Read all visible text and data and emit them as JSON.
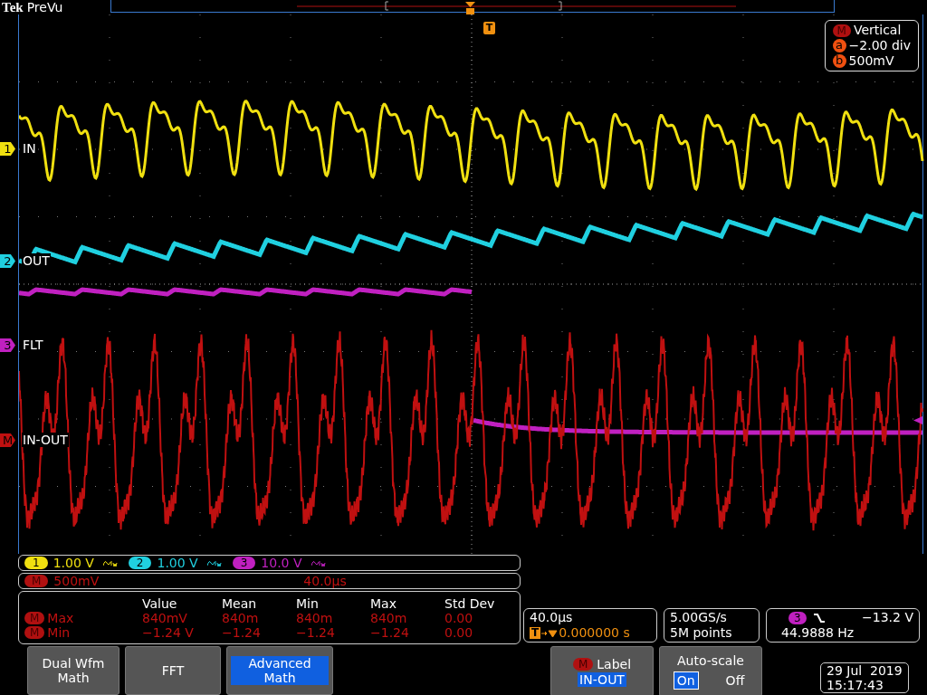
{
  "header": {
    "brand": "Tek",
    "mode": "PreVu",
    "trigger_marker": "T"
  },
  "channels": [
    {
      "number": "1",
      "label": "IN",
      "color": "#f0e010"
    },
    {
      "number": "2",
      "label": "OUT",
      "color": "#20d0e0"
    },
    {
      "number": "3",
      "label": "FLT",
      "color": "#c020c0"
    },
    {
      "number": "M",
      "label": "IN-OUT",
      "color": "#c01010"
    }
  ],
  "vertical_box": {
    "badge": "M",
    "title": "Vertical",
    "rows": [
      {
        "key": "a",
        "value": "−2.00 div"
      },
      {
        "key": "b",
        "value": "500mV"
      }
    ]
  },
  "channel_bar": [
    {
      "badge": "1",
      "scale": "1.00 V",
      "color": "#f0e010"
    },
    {
      "badge": "2",
      "scale": "1.00 V",
      "color": "#20d0e0"
    },
    {
      "badge": "3",
      "scale": "10.0 V",
      "color": "#c020c0"
    }
  ],
  "math_bar": {
    "badge": "M",
    "scale": "500mV",
    "time": "40.0µs"
  },
  "measurements": {
    "columns": [
      "Value",
      "Mean",
      "Min",
      "Max",
      "Std Dev"
    ],
    "rows": [
      {
        "badge": "M",
        "name": "Max",
        "values": [
          "840mV",
          "840m",
          "840m",
          "840m",
          "0.00"
        ]
      },
      {
        "badge": "M",
        "name": "Min",
        "values": [
          "−1.24 V",
          "−1.24",
          "−1.24",
          "−1.24",
          "0.00"
        ]
      }
    ]
  },
  "horizontal": {
    "scale": "40.0µs",
    "badge": "T",
    "position": "0.000000 s"
  },
  "acquisition": {
    "rate": "5.00GS/s",
    "length": "5M points"
  },
  "trigger": {
    "source": "3",
    "level": "−13.2 V",
    "frequency": "44.9888 Hz"
  },
  "menu": [
    {
      "label": "Dual Wfm Math",
      "selected": false
    },
    {
      "label": "FFT",
      "selected": false
    },
    {
      "label": "Advanced Math",
      "selected": true
    }
  ],
  "label_button": {
    "badge": "M",
    "title": "Label",
    "value": "IN-OUT"
  },
  "autoscale": {
    "title": "Auto-scale",
    "options": [
      {
        "label": "On",
        "selected": true
      },
      {
        "label": "Off",
        "selected": false
      }
    ]
  },
  "datetime": {
    "date": "29 Jul  2019",
    "time": "15:17:43"
  }
}
